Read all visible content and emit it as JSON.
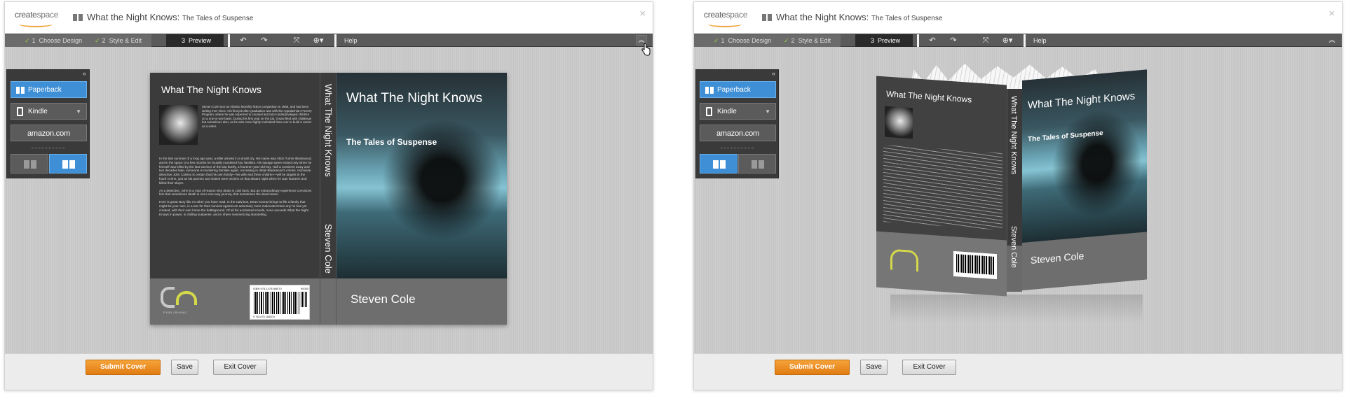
{
  "app": {
    "logo_text_a": "create",
    "logo_text_b": "space",
    "title_main": "What the Night Knows:",
    "title_sub": "The Tales of Suspense",
    "close_icon": "×"
  },
  "toolbar": {
    "steps": [
      {
        "num": "1",
        "label": "Choose Design",
        "state": "done",
        "check": "✓"
      },
      {
        "num": "2",
        "label": "Style & Edit",
        "state": "done",
        "check": "✓"
      },
      {
        "num": "3",
        "label": "Preview",
        "state": "active"
      }
    ],
    "undo_icon": "↶",
    "redo_icon": "↷",
    "fit_icon": "⤧",
    "zoom_icon": "⊕▾",
    "help_label": "Help",
    "collapse_icon": "︽"
  },
  "format_panel": {
    "collapse_icon": "«",
    "paperback_label": "Paperback",
    "kindle_label": "Kindle",
    "kindle_arrow": "▼",
    "amazon_label": "amazon.com"
  },
  "cover": {
    "back_title": "What The Night Knows",
    "bio": "Steven Cole won an Atlantic Monthly fiction competition in 1968, and has been writing ever since. His first job after graduation was with the Appalachian Poverty Program, where he was expected to counsel and tutor underprivileged children on a one-to-one basis. During his first year on the job, it was filled with challenge but sometimes also, as he was more highly motivated than ever to build a career as a writer.",
    "blurb_1": "In the late summer of a long ago year, a killer arrived in a small city. His name was Alton Turner Blackwood, and in the space of a few months he brutally murdered four families. His savage spree ended only when he himself was killed by the last survivor of the last family, a fourteen-year-old boy. Half a continent away and two decades later, someone is murdering families again, recreating in detail Blackwood's crimes. Homicide detective John Calvino is certain that his own family—his wife and three children—will be targets in the fourth crime, just as his parents and sisters were victims on that distant night when he was fourteen and killed their slayer.",
    "blurb_2": "As a detective, John is a man of reason who deals in cold facts. But an extraordinary experience convinces him that sometimes death is not a one-way journey, that sometimes the dead return.",
    "blurb_3": "Here is great story like no other you have read. In the Calvinos, Dean Koontz brings to life a family that might be your own, in a war for their survival against an adversary more malevolent than any he has yet created, with their own home the battleground. Of all his acclaimed novels, none exceeds What the Night Knows in power, in chilling suspense, and in sheer mesmerizing storytelling.",
    "publisher_caption": "PUBLISHING",
    "barcode_top": "ISBN 978-1475168570",
    "barcode_price": "90000",
    "barcode_bottom": "9 781475 168570",
    "spine_title": "What The Night Knows",
    "spine_author": "Steven Cole",
    "front_title": "What The Night Knows",
    "front_subtitle": "The Tales of Suspense",
    "front_author": "Steven Cole"
  },
  "footer": {
    "submit_label": "Submit Cover",
    "save_label": "Save",
    "exit_label": "Exit Cover"
  }
}
